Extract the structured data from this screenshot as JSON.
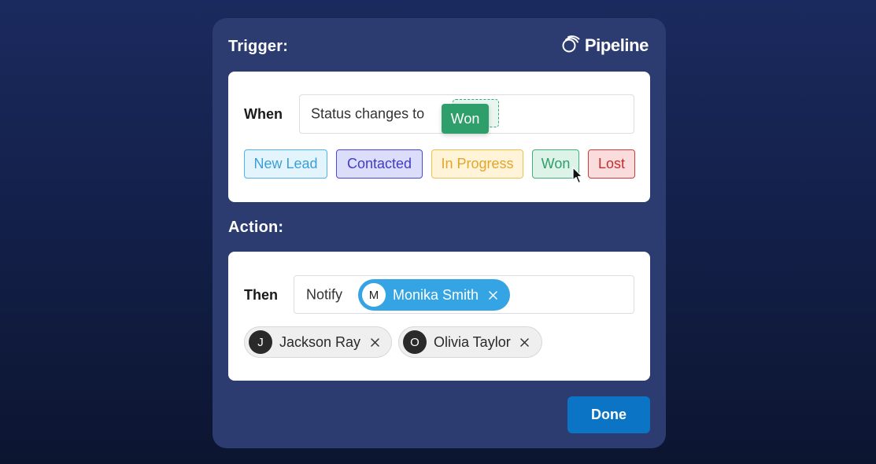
{
  "brand": {
    "name": "Pipeline",
    "icon": "pipeline-logo-icon"
  },
  "trigger": {
    "section_title": "Trigger:",
    "row_label": "When",
    "field_text": "Status changes to",
    "selected_status": "Won",
    "statuses": [
      {
        "label": "New Lead",
        "color": "#3a9fd8"
      },
      {
        "label": "Contacted",
        "color": "#3f3cc8"
      },
      {
        "label": "In Progress",
        "color": "#e5a52a"
      },
      {
        "label": "Won",
        "color": "#2e9e6a"
      },
      {
        "label": "Lost",
        "color": "#c22f2f"
      }
    ]
  },
  "action": {
    "section_title": "Action:",
    "row_label": "Then",
    "field_text": "Notify",
    "selected_recipient": {
      "initial": "M",
      "name": "Monika Smith"
    },
    "available_recipients": [
      {
        "initial": "J",
        "name": "Jackson Ray"
      },
      {
        "initial": "O",
        "name": "Olivia Taylor"
      }
    ]
  },
  "footer": {
    "done_label": "Done"
  },
  "colors": {
    "accent": "#0b74c4",
    "panel": "#2d3c70",
    "chip_selected": "#35a4e4"
  }
}
